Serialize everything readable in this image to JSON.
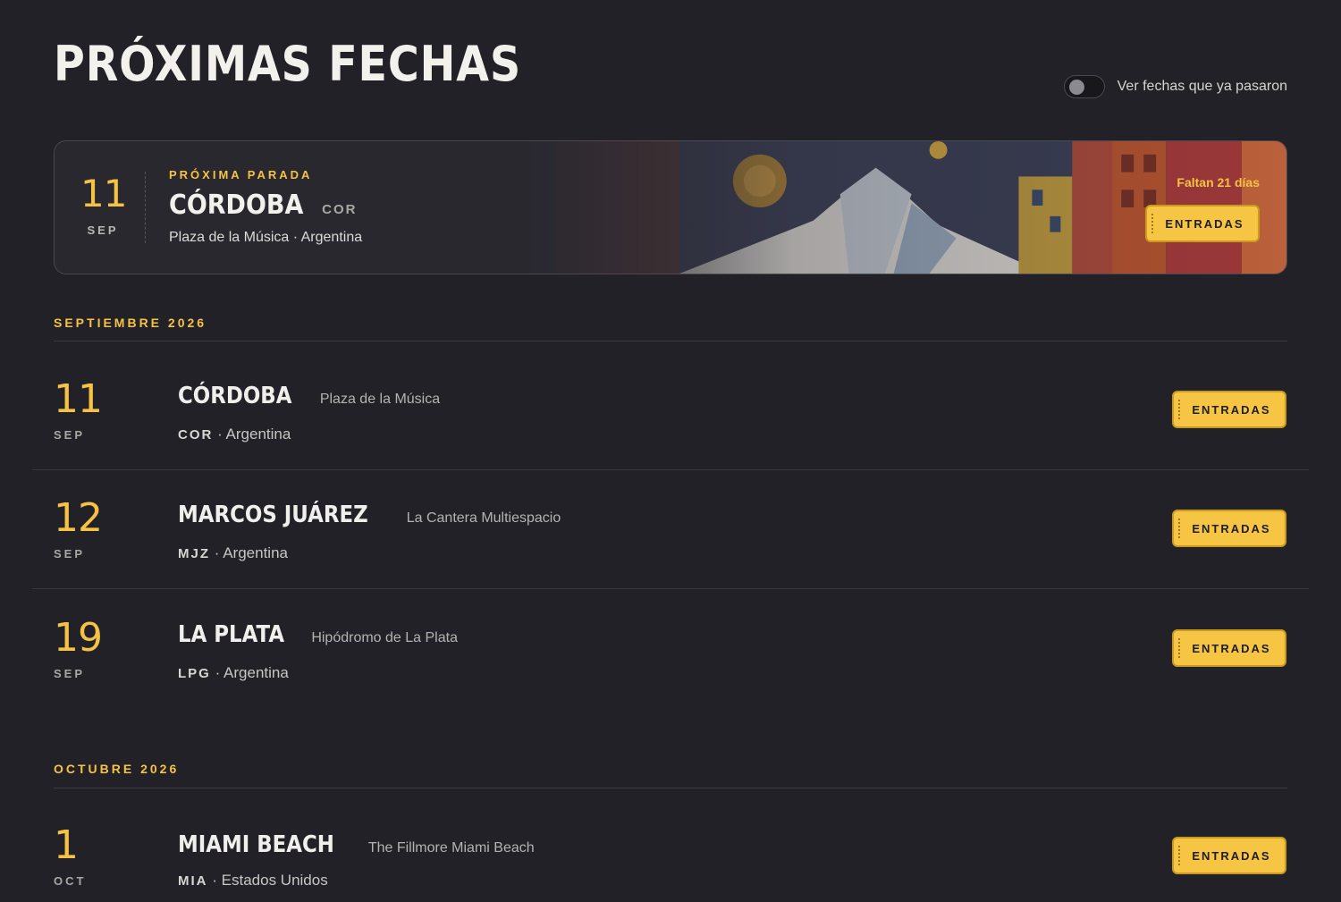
{
  "page": {
    "title": "PRÓXIMAS FECHAS",
    "toggle_label": "Ver fechas que ya pasaron",
    "toggle_on": false
  },
  "colors": {
    "accent": "#f5c243",
    "background": "#222128",
    "button": "#f6c544"
  },
  "hero": {
    "kicker": "PRÓXIMA PARADA",
    "day": "11",
    "month": "SEP",
    "city": "CÓRDOBA",
    "code": "COR",
    "venue_line": "Plaza de la Música · Argentina",
    "countdown": "Faltan 21 días",
    "button_label": "ENTRADAS"
  },
  "months": [
    {
      "header": "SEPTIEMBRE 2026",
      "events": [
        {
          "day": "11",
          "month": "SEP",
          "city": "CÓRDOBA",
          "venue": "Plaza de la Música",
          "code": "COR",
          "country": "Argentina",
          "button_label": "ENTRADAS"
        },
        {
          "day": "12",
          "month": "SEP",
          "city": "MARCOS JUÁREZ",
          "venue": "La Cantera Multiespacio",
          "code": "MJZ",
          "country": "Argentina",
          "button_label": "ENTRADAS"
        },
        {
          "day": "19",
          "month": "SEP",
          "city": "LA PLATA",
          "venue": "Hipódromo de La Plata",
          "code": "LPG",
          "country": "Argentina",
          "button_label": "ENTRADAS"
        }
      ]
    },
    {
      "header": "OCTUBRE 2026",
      "events": [
        {
          "day": "1",
          "month": "OCT",
          "city": "MIAMI BEACH",
          "venue": "The Fillmore Miami Beach",
          "code": "MIA",
          "country": "Estados Unidos",
          "button_label": "ENTRADAS"
        }
      ]
    }
  ],
  "separator": "·"
}
